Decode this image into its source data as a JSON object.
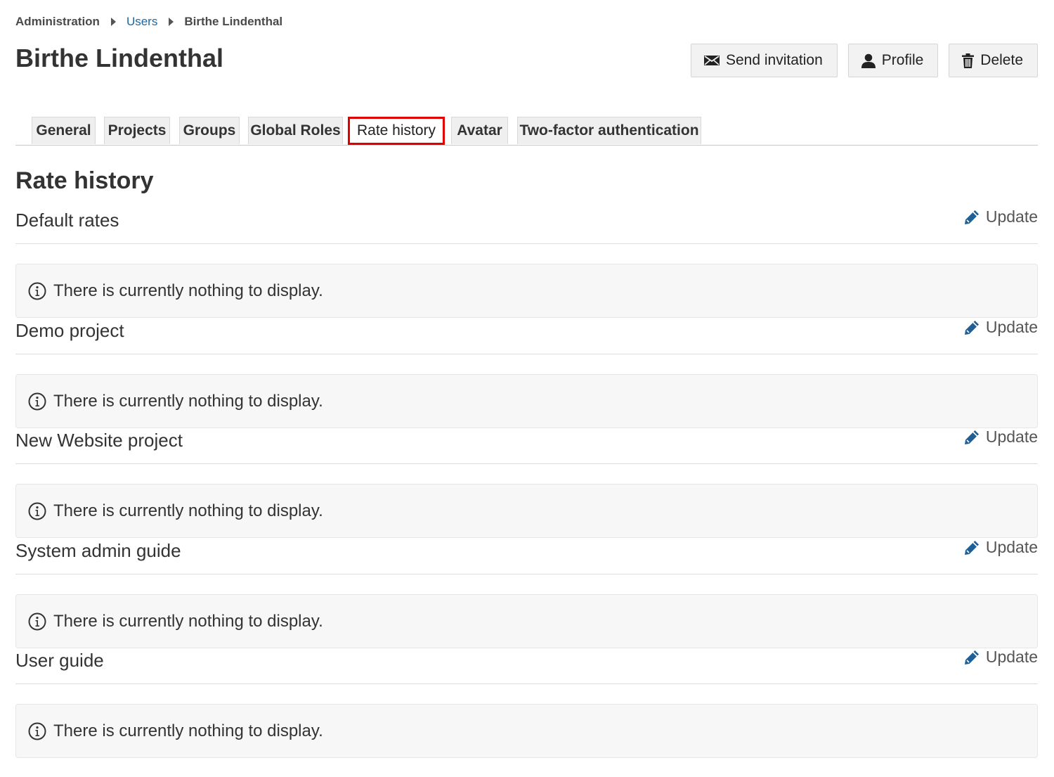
{
  "breadcrumb": {
    "items": [
      "Administration",
      "Users",
      "Birthe Lindenthal"
    ]
  },
  "page_title": "Birthe Lindenthal",
  "toolbar": {
    "send_invitation": "Send invitation",
    "profile": "Profile",
    "delete": "Delete"
  },
  "tabs": [
    {
      "label": "General"
    },
    {
      "label": "Projects"
    },
    {
      "label": "Groups"
    },
    {
      "label": "Global Roles"
    },
    {
      "label": "Rate history",
      "active": true
    },
    {
      "label": "Avatar"
    },
    {
      "label": "Two-factor authentication"
    }
  ],
  "section_title": "Rate history",
  "groups": [
    {
      "title": "Default rates",
      "update_label": "Update",
      "empty_message": "There is currently nothing to display."
    },
    {
      "title": "Demo project",
      "update_label": "Update",
      "empty_message": "There is currently nothing to display."
    },
    {
      "title": "New Website project",
      "update_label": "Update",
      "empty_message": "There is currently nothing to display."
    },
    {
      "title": "System admin guide",
      "update_label": "Update",
      "empty_message": "There is currently nothing to display."
    },
    {
      "title": "User guide",
      "update_label": "Update",
      "empty_message": "There is currently nothing to display."
    }
  ],
  "icons": {
    "send_invitation": "envelope-icon",
    "profile": "user-icon",
    "delete": "trash-icon",
    "update": "pencil-icon",
    "notice": "info-icon"
  },
  "colors": {
    "link": "#1a67a3",
    "active_tab_border": "#e00000",
    "update_icon": "#1f5f96"
  }
}
